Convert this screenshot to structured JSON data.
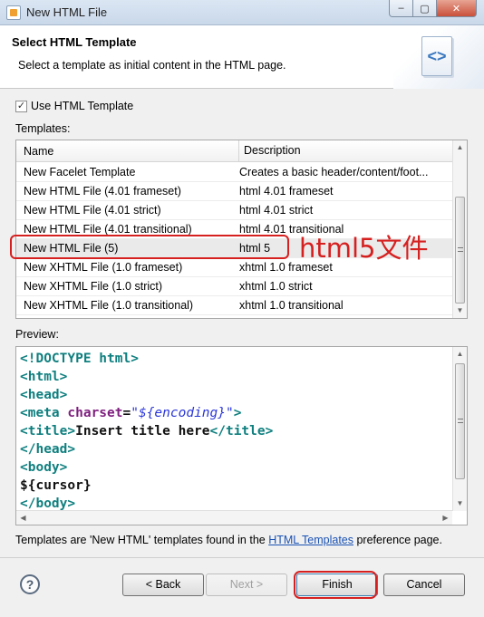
{
  "window": {
    "title": "New HTML File",
    "minimize": "–",
    "maximize": "▢",
    "close": "✕"
  },
  "banner": {
    "title": "Select HTML Template",
    "description": "Select a template as initial content in the HTML page.",
    "icon_glyph": "<>"
  },
  "use_template": {
    "label": "Use HTML Template",
    "checked": true,
    "check_glyph": "✓"
  },
  "templates_label": "Templates:",
  "table": {
    "columns": [
      "Name",
      "Description"
    ],
    "rows": [
      [
        "New Facelet Template",
        "Creates a basic header/content/foot..."
      ],
      [
        "New HTML File (4.01 frameset)",
        "html 4.01 frameset"
      ],
      [
        "New HTML File (4.01 strict)",
        "html 4.01 strict"
      ],
      [
        "New HTML File (4.01 transitional)",
        "html 4.01 transitional"
      ],
      [
        "New HTML File (5)",
        "html 5"
      ],
      [
        "New XHTML File (1.0 frameset)",
        "xhtml 1.0 frameset"
      ],
      [
        "New XHTML File (1.0 strict)",
        "xhtml 1.0 strict"
      ],
      [
        "New XHTML File (1.0 transitional)",
        "xhtml 1.0 transitional"
      ]
    ],
    "selected_index": 4
  },
  "annotation": {
    "text": "html5文件"
  },
  "preview_label": "Preview:",
  "preview_code": [
    [
      {
        "t": "tag",
        "v": "<!DOCTYPE html>"
      }
    ],
    [
      {
        "t": "tag",
        "v": "<html>"
      }
    ],
    [
      {
        "t": "tag",
        "v": "<head>"
      }
    ],
    [
      {
        "t": "tag",
        "v": "<meta "
      },
      {
        "t": "attr",
        "v": "charset"
      },
      {
        "t": "plain",
        "v": "="
      },
      {
        "t": "str",
        "v": "\"${encoding}\""
      },
      {
        "t": "tag",
        "v": ">"
      }
    ],
    [
      {
        "t": "tag",
        "v": "<title>"
      },
      {
        "t": "plain",
        "v": "Insert title here"
      },
      {
        "t": "tag",
        "v": "</title>"
      }
    ],
    [
      {
        "t": "tag",
        "v": "</head>"
      }
    ],
    [
      {
        "t": "tag",
        "v": "<body>"
      }
    ],
    [
      {
        "t": "plain",
        "v": "${cursor}"
      }
    ],
    [
      {
        "t": "tag",
        "v": "</body>"
      }
    ]
  ],
  "footer": {
    "prefix": "Templates are 'New HTML' templates found in the ",
    "link": "HTML Templates",
    "suffix": " preference page."
  },
  "buttons": {
    "help": "?",
    "back": "< Back",
    "next": "Next >",
    "finish": "Finish",
    "cancel": "Cancel"
  },
  "colors": {
    "annotation": "#d62020",
    "link": "#1a52b4",
    "code_tag": "#0f7f7f",
    "code_attr": "#7f1f7f",
    "code_string": "#2a36d9"
  }
}
